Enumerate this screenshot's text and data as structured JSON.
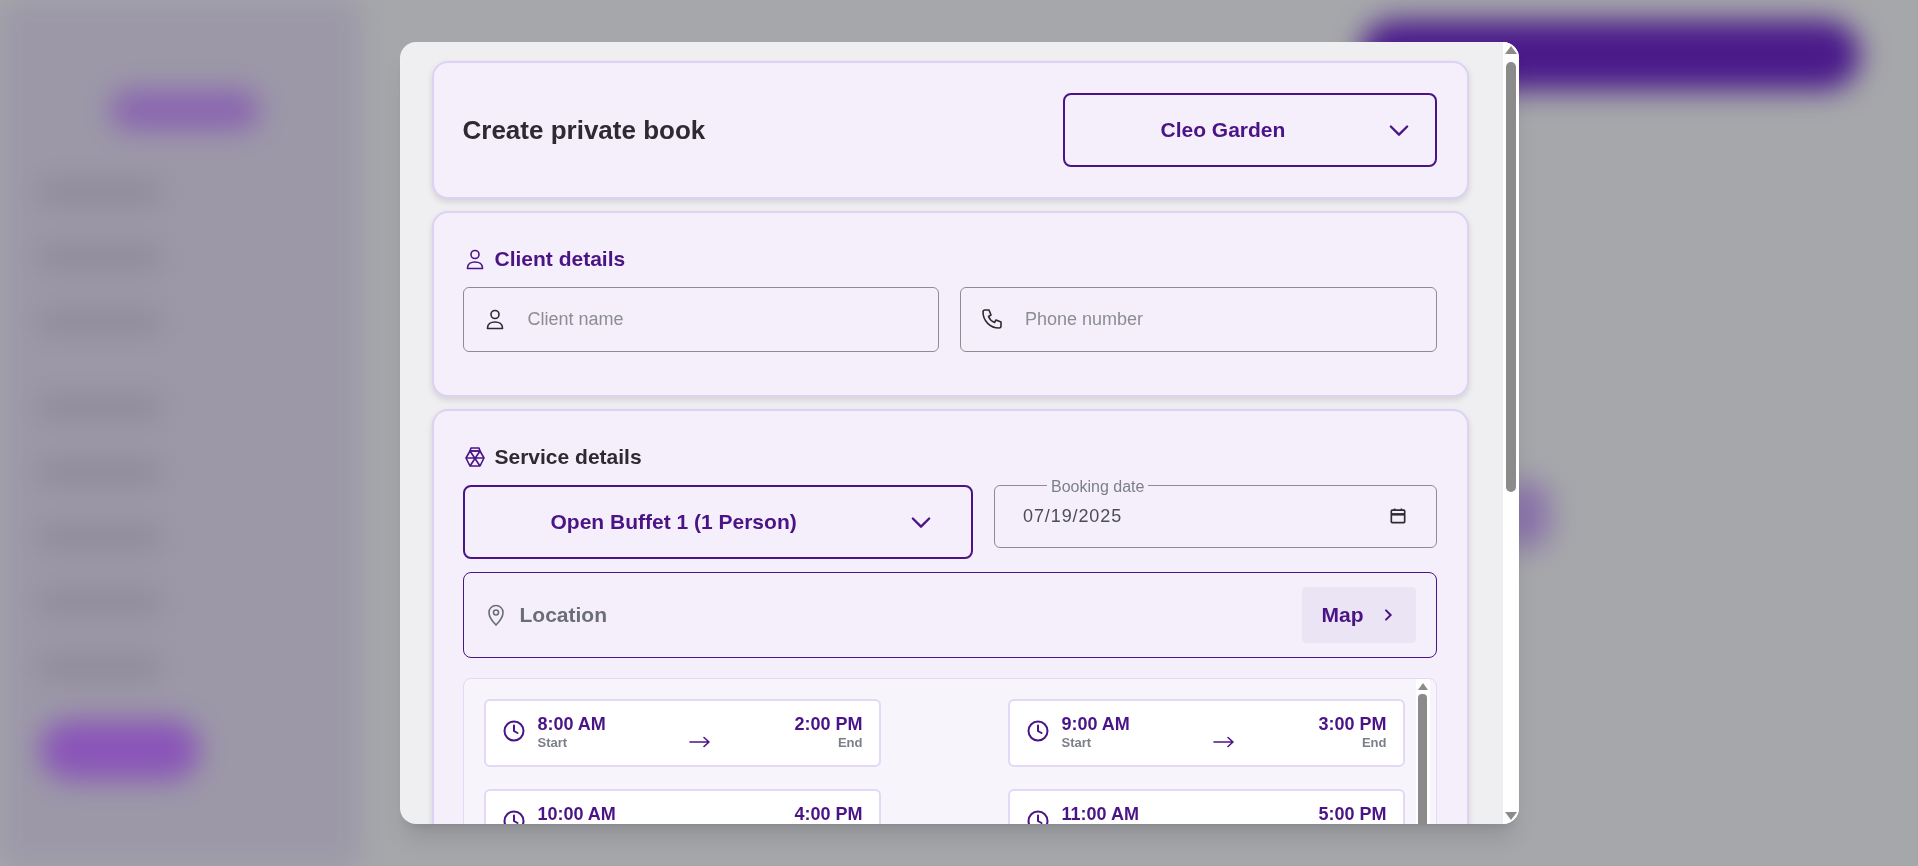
{
  "header": {
    "title": "Create private book",
    "venue": "Cleo Garden"
  },
  "client": {
    "heading": "Client details",
    "fields": [
      {
        "kind": "person",
        "placeholder": "Client name"
      },
      {
        "kind": "phone",
        "placeholder": "Phone number"
      }
    ]
  },
  "service": {
    "heading": "Service details",
    "package": "Open Buffet 1 (1 Person)",
    "date": {
      "label": "Booking date",
      "value": "07/19/2025"
    },
    "location": {
      "placeholder": "Location",
      "button": "Map"
    },
    "slots": [
      {
        "start": "8:00 AM",
        "start_caption": "Start",
        "end": "2:00 PM",
        "end_caption": "End"
      },
      {
        "start": "9:00 AM",
        "start_caption": "Start",
        "end": "3:00 PM",
        "end_caption": "End"
      },
      {
        "start": "10:00 AM",
        "end": "4:00 PM"
      },
      {
        "start": "11:00 AM",
        "end": "5:00 PM"
      }
    ]
  }
}
